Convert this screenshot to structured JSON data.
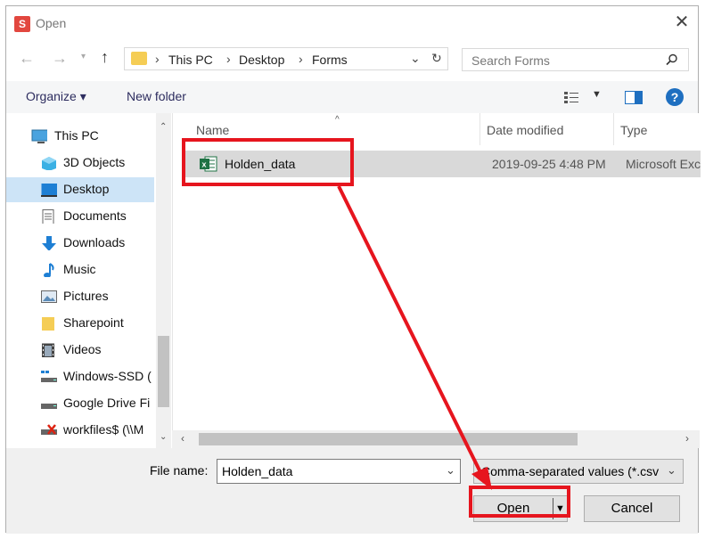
{
  "window": {
    "app_icon_letter": "S",
    "title": "Open",
    "close_glyph": "✕"
  },
  "nav": {
    "breadcrumb": [
      "This PC",
      "Desktop",
      "Forms"
    ],
    "search_placeholder": "Search Forms"
  },
  "toolbar": {
    "organize_label": "Organize ▾",
    "new_folder_label": "New folder",
    "help_glyph": "?"
  },
  "sidebar": {
    "items": [
      {
        "label": "This PC",
        "icon": "computer-icon"
      },
      {
        "label": "3D Objects",
        "icon": "cube-icon"
      },
      {
        "label": "Desktop",
        "icon": "desktop-icon"
      },
      {
        "label": "Documents",
        "icon": "document-icon"
      },
      {
        "label": "Downloads",
        "icon": "download-icon"
      },
      {
        "label": "Music",
        "icon": "music-icon"
      },
      {
        "label": "Pictures",
        "icon": "pictures-icon"
      },
      {
        "label": "Sharepoint",
        "icon": "folder-icon"
      },
      {
        "label": "Videos",
        "icon": "video-icon"
      },
      {
        "label": "Windows-SSD (",
        "icon": "drive-icon"
      },
      {
        "label": "Google Drive Fi",
        "icon": "drive-icon"
      },
      {
        "label": "workfiles$ (\\\\M",
        "icon": "network-drive-icon"
      }
    ],
    "selected": "Desktop"
  },
  "file_list": {
    "columns": [
      "Name",
      "Date modified",
      "Type"
    ],
    "files": [
      {
        "name": "Holden_data",
        "date_modified": "2019-09-25 4:48 PM",
        "type": "Microsoft Exc",
        "icon": "excel-icon"
      }
    ]
  },
  "footer": {
    "file_name_label": "File name:",
    "file_name_value": "Holden_data",
    "file_type_value": "Comma-separated values (*.csv",
    "open_label": "Open",
    "cancel_label": "Cancel"
  },
  "colors": {
    "annotation_red": "#e6151e",
    "selected_bg": "#cde4f7",
    "excel_green": "#1f7244"
  }
}
